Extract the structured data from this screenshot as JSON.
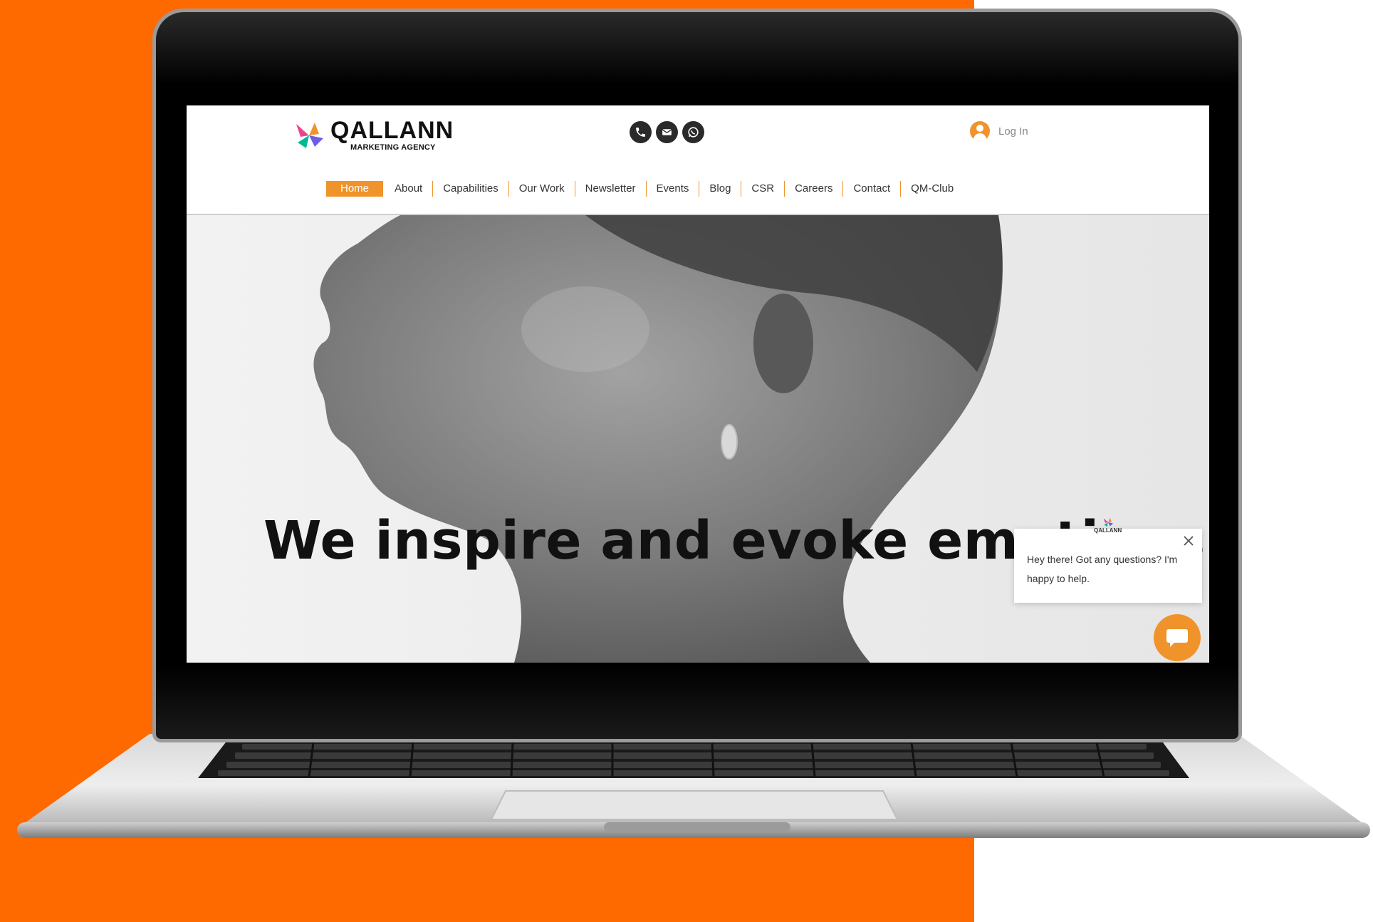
{
  "brand": {
    "name": "QALLANN",
    "tagline": "MARKETING AGENCY"
  },
  "header": {
    "contact_icons": [
      "phone-icon",
      "email-icon",
      "whatsapp-icon"
    ],
    "login_label": "Log In"
  },
  "nav": {
    "items": [
      {
        "label": "Home",
        "active": true
      },
      {
        "label": "About"
      },
      {
        "label": "Capabilities"
      },
      {
        "label": "Our Work"
      },
      {
        "label": "Newsletter"
      },
      {
        "label": "Events"
      },
      {
        "label": "Blog"
      },
      {
        "label": "CSR"
      },
      {
        "label": "Careers"
      },
      {
        "label": "Contact"
      },
      {
        "label": "QM-Club"
      }
    ]
  },
  "hero": {
    "title": "We inspire and evoke emotions."
  },
  "chat": {
    "brand": "QALLANN",
    "message": "Hey there! Got any questions? I'm happy to help."
  },
  "colors": {
    "background_accent": "#ff6a00",
    "brand_orange": "#f0932b",
    "text_dark": "#111111"
  }
}
